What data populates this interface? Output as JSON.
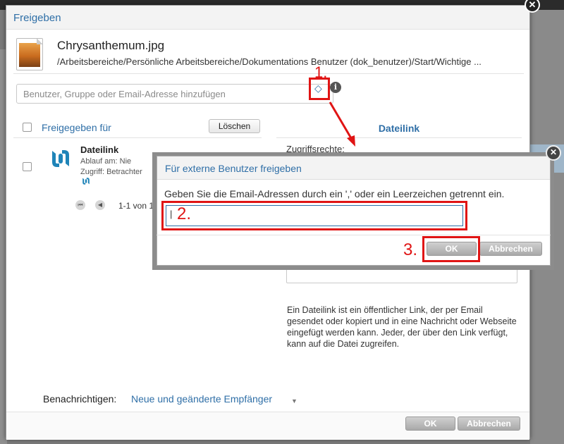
{
  "dialog": {
    "title": "Freigeben",
    "close_glyph": "✕"
  },
  "file": {
    "name": "Chrysanthemum.jpg",
    "path": "/Arbeitsbereiche/Persönliche Arbeitsbereiche/Dokumentations Benutzer (dok_benutzer)/Start/Wichtige ..."
  },
  "search": {
    "placeholder": "Benutzer, Gruppe oder Email-Adresse hinzufügen"
  },
  "left_panel": {
    "header_label": "Freigegeben für",
    "delete_label": "Löschen",
    "entry": {
      "title": "Dateilink",
      "expiry": "Ablauf am: Nie",
      "access": "Zugriff: Betrachter"
    },
    "pager_text": "1-1 von 1"
  },
  "right_panel": {
    "header": "Dateilink",
    "access_label": "Zugriffsrechte:",
    "description": "Ein Dateilink ist ein öffentlicher Link, der per Email gesendet oder kopiert und in eine Nachricht oder Webseite eingefügt werden kann. Jeder, der über den Link verfügt, kann auf die Datei zugreifen."
  },
  "notify": {
    "label": "Benachrichtigen:",
    "value": "Neue und geänderte Empfänger"
  },
  "footer": {
    "ok_label": "OK",
    "cancel_label": "Abbrechen"
  },
  "overlay": {
    "title": "Für externe Benutzer freigeben",
    "instruction": "Geben Sie die Email-Adressen durch ein ',' oder ein Leerzeichen getrennt ein.",
    "input_value": "|",
    "ok_label": "OK",
    "cancel_label": "Abbrechen",
    "close_glyph": "✕"
  },
  "annotations": {
    "step1": "1.",
    "step2": "2.",
    "step3": "3."
  },
  "colors": {
    "accent": "#2f6fa7",
    "highlight": "#e01414"
  },
  "icons": {
    "external_share": "envelope-diamond-icon",
    "info": "info-icon",
    "file_link": "link-logo-icon"
  }
}
